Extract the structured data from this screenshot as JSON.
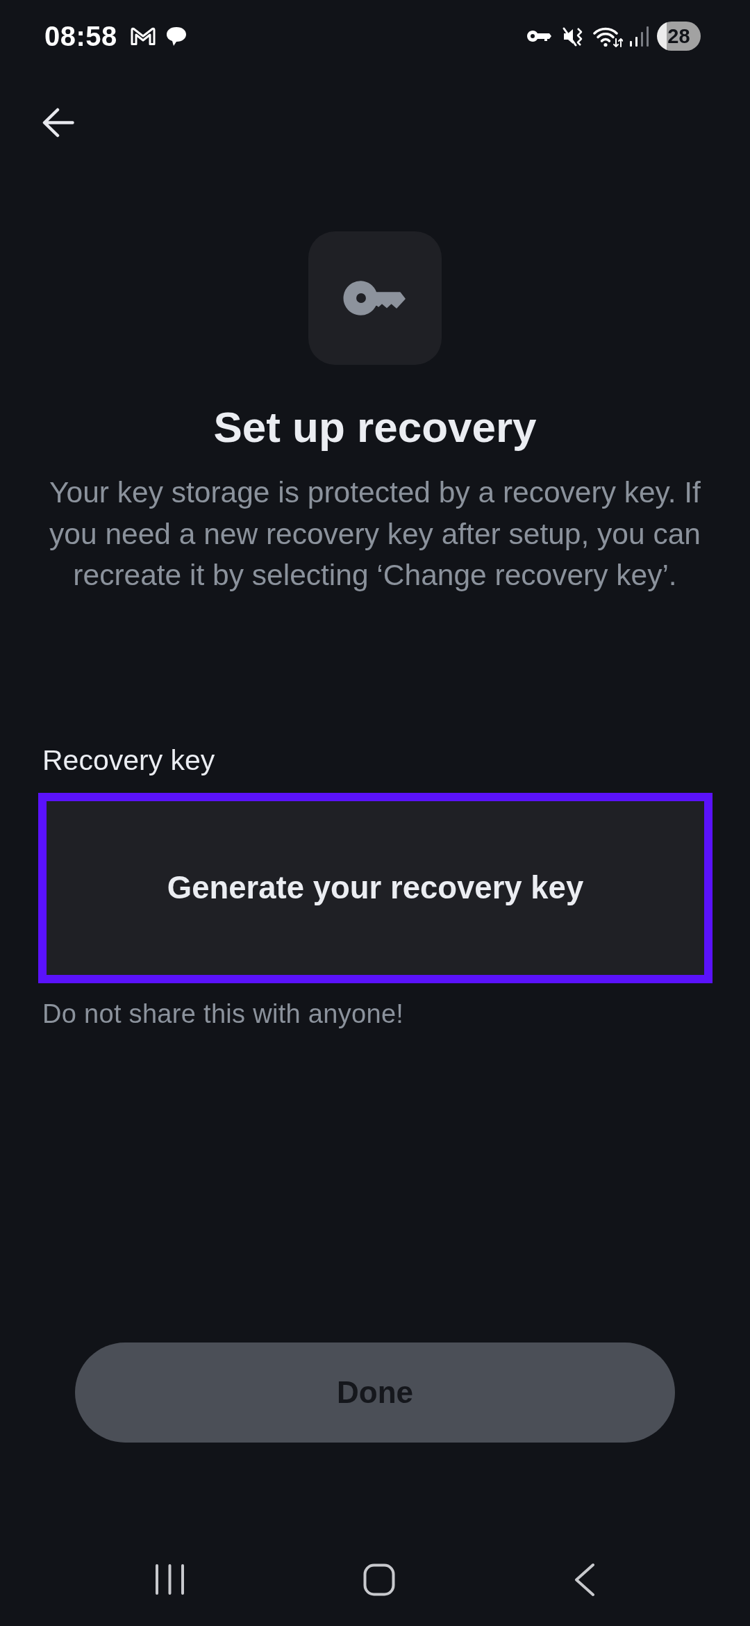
{
  "status_bar": {
    "time": "08:58",
    "battery": "28"
  },
  "title": "Set up recovery",
  "description": "Your key storage is protected by a recovery key. If you need a new recovery key after setup, you can recreate it by selecting ‘Change recovery key’.",
  "recovery_key": {
    "label": "Recovery key",
    "button": "Generate your recovery key",
    "focused": true,
    "hint": "Do not share this with anyone!"
  },
  "done_button": {
    "label": "Done",
    "disabled": true
  }
}
